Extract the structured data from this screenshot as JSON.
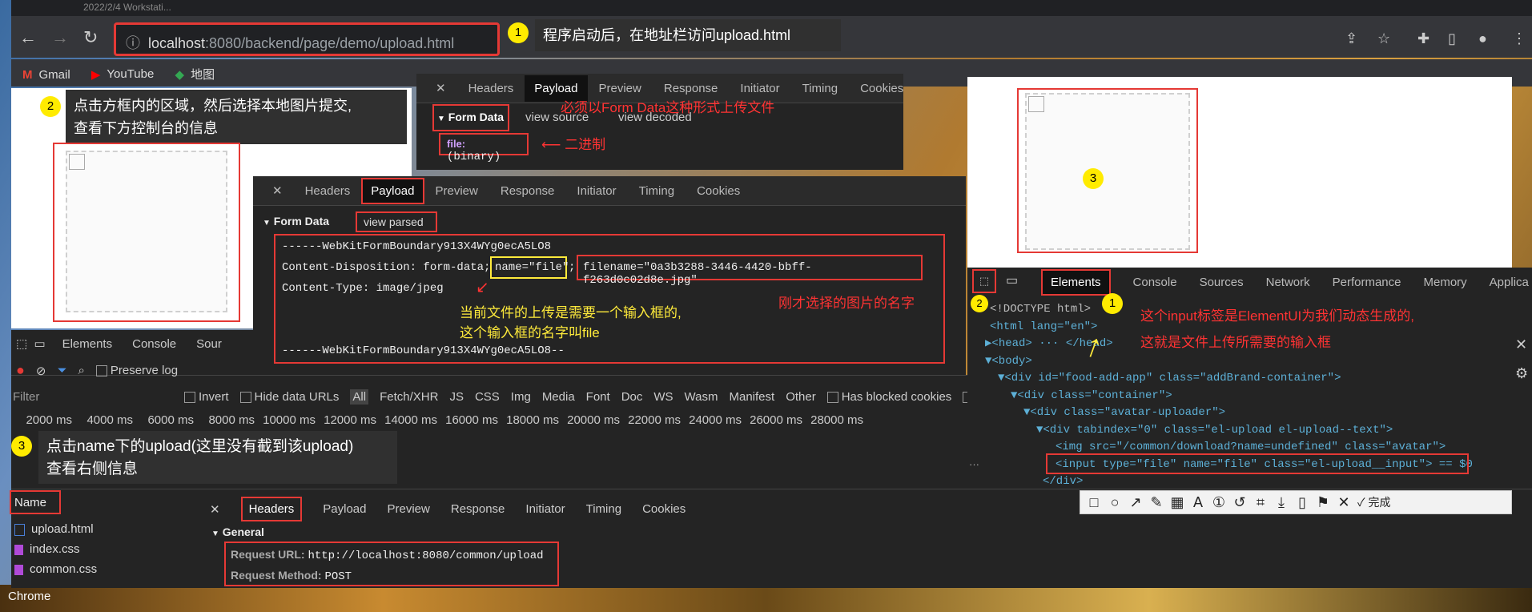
{
  "window": {
    "top_text": "2022/2/4     Workstati..."
  },
  "browser": {
    "url_host": "localhost",
    "url_rest": ":8080/backend/page/demo/upload.html",
    "bookmarks": [
      {
        "label": "Gmail",
        "icon": "gmail-icon"
      },
      {
        "label": "YouTube",
        "icon": "youtube-icon"
      },
      {
        "label": "地图",
        "icon": "maps-icon"
      }
    ],
    "taskbar_label": "Chrome"
  },
  "annotations": {
    "step1_badge": "1",
    "step1_text": "程序启动后，在地址栏访问upload.html",
    "step2_badge": "2",
    "step2_text_line1": "点击方框内的区域，然后选择本地图片提交,",
    "step2_text_line2": "查看下方控制台的信息",
    "step3_badge": "3",
    "step3_text_line1": "点击name下的upload(这里没有截到该upload)",
    "step3_text_line2": "查看右侧信息",
    "must_form_data": "必须以Form Data这种形式上传文件",
    "binary_note": "二进制",
    "input_note_line1": "当前文件的上传是需要一个输入框的,",
    "input_note_line2": "这个输入框的名字叫file",
    "filename_note": "刚才选择的图片的名字",
    "right_badge1": "1",
    "right_badge2": "2",
    "right_badge3": "3",
    "elementui_note_line1": "这个input标签是ElementUI为我们动态生成的,",
    "elementui_note_line2": "这就是文件上传所需要的输入框"
  },
  "payload_small": {
    "tabs": [
      "Headers",
      "Payload",
      "Preview",
      "Response",
      "Initiator",
      "Timing",
      "Cookies"
    ],
    "active": "Payload",
    "section": "Form Data",
    "view_source": "view source",
    "view_decoded": "view decoded",
    "file_key": "file:",
    "file_val": "(binary)"
  },
  "payload_big": {
    "tabs": [
      "Headers",
      "Payload",
      "Preview",
      "Response",
      "Initiator",
      "Timing",
      "Cookies"
    ],
    "active": "Payload",
    "section": "Form Data",
    "view_parsed": "view parsed",
    "line1": "------WebKitFormBoundary913X4WYg0ecA5LO8",
    "line2_prefix": "Content-Disposition: form-data;",
    "line2_name": "name=\"file\"",
    "line2_sep": ";",
    "line2_filename": "filename=\"0a3b3288-3446-4420-bbff-f263d0c02d8e.jpg\"",
    "line3": "Content-Type: image/jpeg",
    "line4": "------WebKitFormBoundary913X4WYg0ecA5LO8--"
  },
  "network": {
    "top_tabs": [
      "Elements",
      "Console",
      "Sour"
    ],
    "preserve_log": "Preserve log",
    "filter_placeholder": "Filter",
    "invert": "Invert",
    "hide_data_urls": "Hide data URLs",
    "types": [
      "All",
      "Fetch/XHR",
      "JS",
      "CSS",
      "Img",
      "Media",
      "Font",
      "Doc",
      "WS",
      "Wasm",
      "Manifest",
      "Other"
    ],
    "has_blocked_cookies": "Has blocked cookies",
    "blocked_trunc": "B",
    "timeline": [
      "2000 ms",
      "4000 ms",
      "6000 ms",
      "8000 ms",
      "10000 ms",
      "12000 ms",
      "14000 ms",
      "16000 ms",
      "18000 ms",
      "20000 ms",
      "22000 ms",
      "24000 ms",
      "26000 ms",
      "28000 ms"
    ],
    "name_header": "Name",
    "files": [
      {
        "name": "upload.html",
        "color": "#4a7fd8"
      },
      {
        "name": "index.css",
        "color": "#b04ad8"
      },
      {
        "name": "common.css",
        "color": "#b04ad8"
      }
    ],
    "detail_tabs": [
      "Headers",
      "Payload",
      "Preview",
      "Response",
      "Initiator",
      "Timing",
      "Cookies"
    ],
    "detail_active": "Headers",
    "general": "General",
    "request_url_label": "Request URL:",
    "request_url": "http://localhost:8080/common/upload",
    "request_method_label": "Request Method:",
    "request_method": "POST"
  },
  "elements_panel": {
    "tabs": [
      "Elements",
      "Console",
      "Sources",
      "Network",
      "Performance",
      "Memory",
      "Applica"
    ],
    "active": "Elements",
    "lines": [
      "<!DOCTYPE html>",
      "<html lang=\"en\">",
      "▶<head> ··· </head>",
      "▼<body>",
      "▼<div id=\"food-add-app\" class=\"addBrand-container\">",
      "▼<div class=\"container\">",
      "▼<div class=\"avatar-uploader\">",
      "▼<div tabindex=\"0\" class=\"el-upload el-upload--text\">",
      "<img src=\"/common/download?name=undefined\" class=\"avatar\">",
      "<input type=\"file\" name=\"file\" class=\"el-upload__input\"> == $0",
      "</div>"
    ],
    "done_label": "完成"
  }
}
